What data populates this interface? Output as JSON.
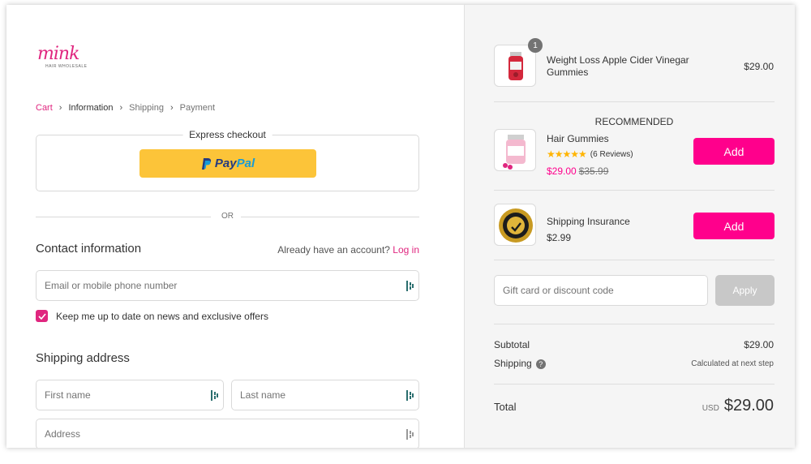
{
  "logo": {
    "text": "mink",
    "sub": "HAIR WHOLESALE"
  },
  "breadcrumb": {
    "cart": "Cart",
    "information": "Information",
    "shipping": "Shipping",
    "payment": "Payment"
  },
  "express": {
    "title": "Express checkout",
    "paypal_p": "P",
    "paypal_pay": "Pay",
    "paypal_pal": "Pal"
  },
  "divider": {
    "or": "OR"
  },
  "contact": {
    "title": "Contact information",
    "account_hint": "Already have an account?",
    "login": "Log in",
    "email_placeholder": "Email or mobile phone number",
    "newsletter_label": "Keep me up to date on news and exclusive offers",
    "newsletter_checked": true
  },
  "shipping_address": {
    "title": "Shipping address",
    "first_name_placeholder": "First name",
    "last_name_placeholder": "Last name",
    "address_placeholder": "Address"
  },
  "summary": {
    "cart_item": {
      "quantity": "1",
      "name_line1": "Weight Loss Apple Cider Vinegar",
      "name_line2": "Gummies",
      "price": "$29.00"
    },
    "recommended_label": "RECOMMENDED",
    "recommended": [
      {
        "name": "Hair Gummies",
        "stars": "★★★★★",
        "reviews": "(6 Reviews)",
        "sale_price": "$29.00",
        "old_price": "$35.99",
        "add": "Add"
      },
      {
        "name": "Shipping Insurance",
        "price": "$2.99",
        "add": "Add"
      }
    ],
    "discount_placeholder": "Gift card or discount code",
    "apply": "Apply",
    "subtotal_label": "Subtotal",
    "subtotal": "$29.00",
    "shipping_label": "Shipping",
    "shipping_value": "Calculated at next step",
    "total_label": "Total",
    "currency": "USD",
    "total": "$29.00"
  },
  "colors": {
    "accent": "#e0267f",
    "add_button": "#ff008c",
    "paypal": "#fcc439",
    "sidebar_bg": "#f5f5f5"
  }
}
